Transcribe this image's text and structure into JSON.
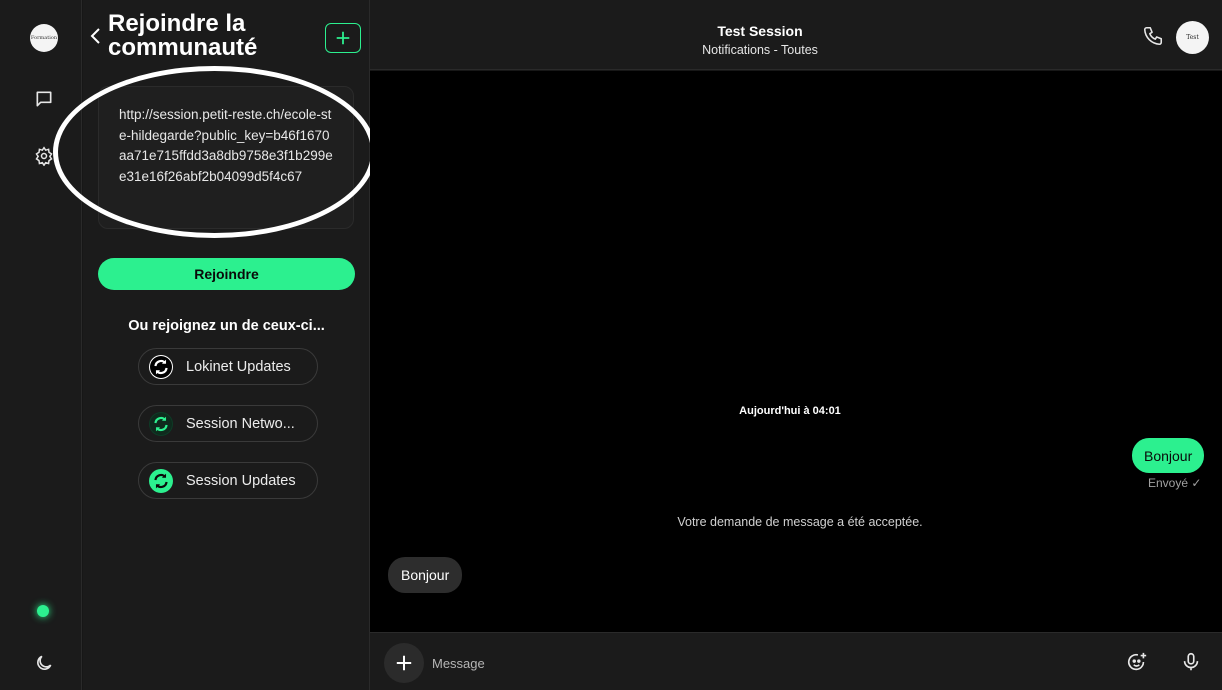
{
  "accent_color": "#2cf08f",
  "rail": {
    "avatar_text": "Formation",
    "icons": [
      "chat-icon",
      "gear-icon",
      "moon-icon"
    ]
  },
  "join_panel": {
    "title_line1": "Rejoindre la",
    "title_line2": "communauté",
    "url": "http://session.petit-reste.ch/ecole-ste-hildegarde?public_key=b46f1670aa71e715ffdd3a8db9758e3f1b299ee31e16f26abf2b04099d5f4c67",
    "join_label": "Rejoindre",
    "or_join_label": "Ou rejoignez un de ceux-ci...",
    "communities": [
      {
        "label": "Lokinet Updates",
        "icon": "refresh-icon"
      },
      {
        "label": "Session Netwo...",
        "icon": "refresh-icon"
      },
      {
        "label": "Session Updates",
        "icon": "refresh-icon"
      }
    ]
  },
  "conversation": {
    "title": "Test Session",
    "subtitle": "Notifications - Toutes",
    "avatar_text": "Test"
  },
  "messages": {
    "date_separator": "Aujourd'hui à 04:01",
    "outgoing_text": "Bonjour",
    "outgoing_status": "Envoyé ✓",
    "request_accepted": "Votre demande de message a été acceptée.",
    "incoming_text": "Bonjour"
  },
  "composer": {
    "placeholder": "Message"
  }
}
